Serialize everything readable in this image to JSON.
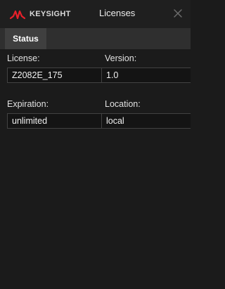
{
  "brand": {
    "name": "KEYSIGHT",
    "logo_icon": "keysight-wave-logo",
    "logo_color": "#e8202a"
  },
  "window": {
    "title": "Licenses",
    "close_icon": "close-icon"
  },
  "tabs": [
    {
      "label": "Status",
      "active": true
    }
  ],
  "fields": {
    "license": {
      "label": "License:",
      "value": "Z2082E_175"
    },
    "version": {
      "label": "Version:",
      "value": "1.0"
    },
    "expiration": {
      "label": "Expiration:",
      "value": "unlimited"
    },
    "location": {
      "label": "Location:",
      "value": "local"
    }
  }
}
